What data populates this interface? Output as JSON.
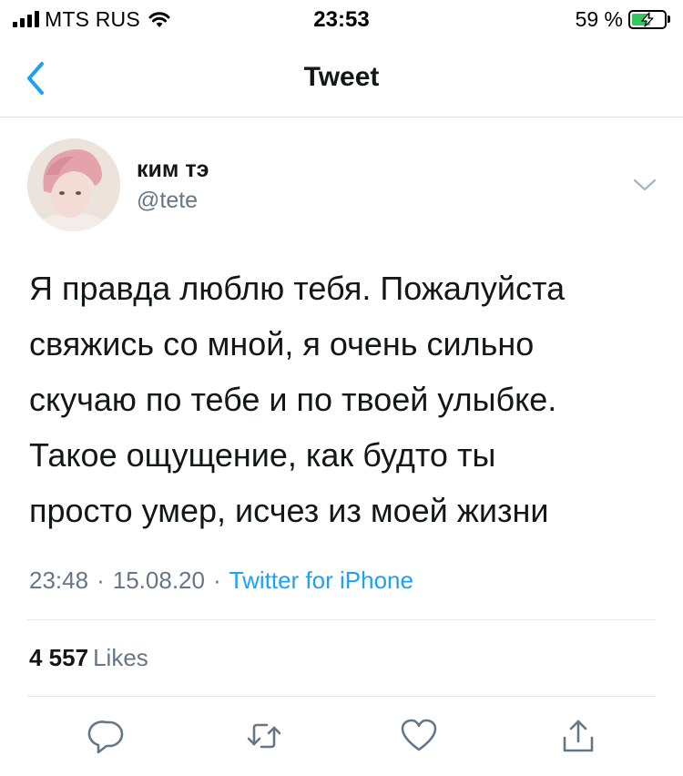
{
  "status_bar": {
    "carrier": "MTS RUS",
    "time": "23:53",
    "battery_percent": "59 %",
    "battery_level": 0.59,
    "charging": true
  },
  "nav": {
    "title": "Tweet",
    "back_icon": "chevron-left-icon"
  },
  "tweet": {
    "display_name": "ким тэ",
    "handle": "@tete",
    "text_lines": [
      "Я правда люблю тебя. Пожалуйста",
      "свяжись со мной, я очень сильно",
      "скучаю по тебе и по твоей улыбке.",
      "Такое ощущение, как будто ты",
      "просто умер, исчез из моей жизни"
    ],
    "time": "23:48",
    "separator": "·",
    "date": "15.08.20",
    "source": "Twitter for iPhone",
    "likes_count": "4 557",
    "likes_label": "Likes"
  },
  "actions": [
    {
      "icon": "reply-icon"
    },
    {
      "icon": "retweet-icon"
    },
    {
      "icon": "like-icon"
    },
    {
      "icon": "share-icon"
    }
  ],
  "colors": {
    "accent": "#1da1f2",
    "muted_text": "#657786",
    "battery_charging": "#34c759"
  }
}
